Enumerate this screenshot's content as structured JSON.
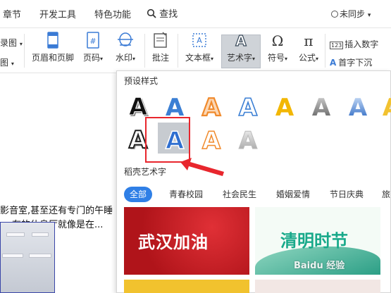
{
  "menu": {
    "items": [
      "章节",
      "开发工具",
      "特色功能"
    ],
    "search_label": "查找",
    "sync_label": "未同步"
  },
  "ribbon": {
    "left_partial_1": "录图",
    "left_partial_2": "图",
    "header_footer": "页眉和页脚",
    "page_number": "页码",
    "watermark": "水印",
    "annotation": "批注",
    "textbox": "文本框",
    "wordart": "艺术字",
    "symbol": "符号",
    "formula": "公式",
    "insert_number": "插入数字",
    "drop_cap": "首字下沉"
  },
  "doc": {
    "line1": "影音室,甚至还有专门的午睡",
    "line2": "，有的休息厅就像是在..."
  },
  "panel": {
    "preset_title": "预设样式",
    "docer_title": "稻壳艺术字",
    "tabs": [
      "全部",
      "青春校园",
      "社会民生",
      "婚姻爱情",
      "节日庆典",
      "旅"
    ],
    "card1_text": "武汉加油",
    "card2_text": "清明时节",
    "watermark_text": "Baidu 经验",
    "wordart_letter": "A"
  },
  "colors": {
    "accent_blue": "#2f7fe6",
    "highlight_red": "#e8262d",
    "card_red": "#c9171c",
    "wordart_orange": "#f08a2c",
    "wordart_yellow": "#f2b705"
  }
}
